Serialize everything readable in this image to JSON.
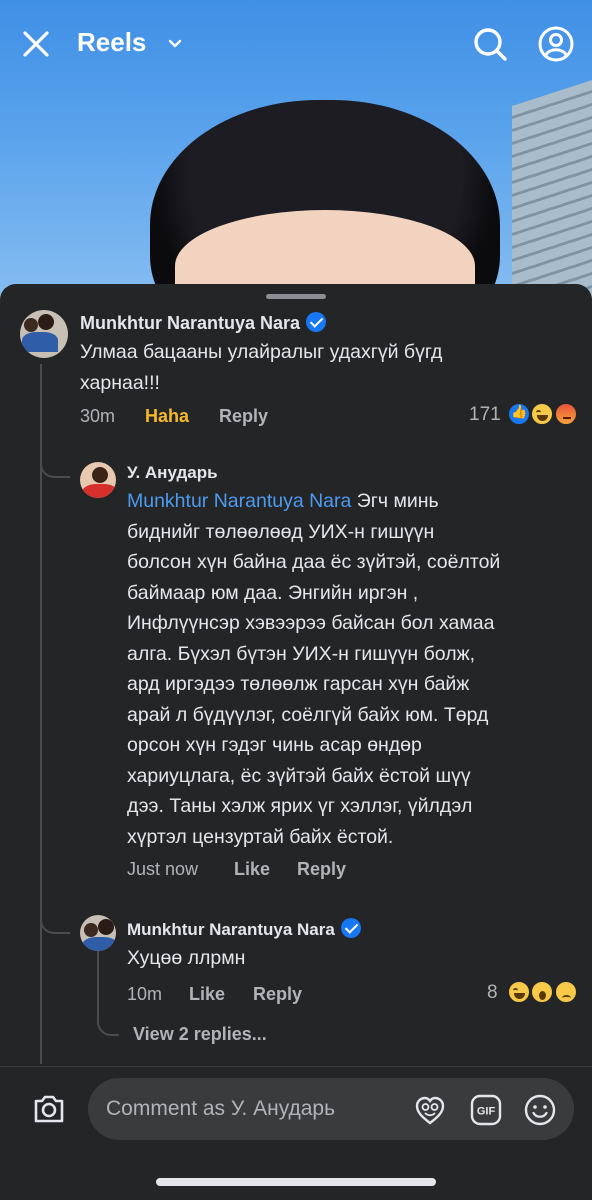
{
  "header": {
    "title": "Reels",
    "close_icon": "close-icon",
    "search_icon": "search-icon",
    "profile_icon": "profile-icon"
  },
  "comments": [
    {
      "author": "Munkhtur Narantuya Nara",
      "verified": true,
      "lines": [
        "Улмаа бацааны улайралыг удахгүй бүгд",
        "харнаа!!!"
      ],
      "time": "30m",
      "reaction_label": "Haha",
      "reply_label": "Reply",
      "reaction_count": "171"
    },
    {
      "author": "У. Анударь",
      "mention": "Munkhtur Narantuya Nara",
      "lines": [
        "Эгч минь",
        "биднийг төлөөлөөд УИХ-н гишүүн",
        "болсон хүн байна даа ёс зүйтэй, соёлтой",
        "баймаар юм даа. Энгийн иргэн ,",
        "Инфлүүнсэр хэвээрээ байсан бол хамаа",
        "алга. Бүхэл бүтэн УИХ-н гишүүн болж,",
        "ард иргэдээ төлөөлж гарсан хүн байж",
        "арай л бүдүүлэг, соёлгүй байх юм. Төрд",
        "орсон хүн гэдэг чинь асар өндөр",
        "хариуцлага, ёс зүйтэй байх ёстой шүү",
        "дээ. Таны хэлж ярих үг хэллэг, үйлдэл",
        "хүртэл цензуртай байх ёстой."
      ],
      "time": "Just now",
      "like_label": "Like",
      "reply_label": "Reply"
    },
    {
      "author": "Munkhtur Narantuya Nara",
      "verified": true,
      "lines": [
        "Хуцөө ллрмн"
      ],
      "time": "10m",
      "like_label": "Like",
      "reply_label": "Reply",
      "reaction_count": "8"
    }
  ],
  "view_replies": "View 2 replies...",
  "composer": {
    "placeholder": "Comment as У. Анударь",
    "gif_label": "GIF"
  },
  "colors": {
    "sheet": "#242526",
    "text": "#e4e6eb",
    "muted": "#b0b3b8",
    "mention": "#4d9bf0",
    "haha": "#f7b928",
    "verified": "#1877f2"
  }
}
